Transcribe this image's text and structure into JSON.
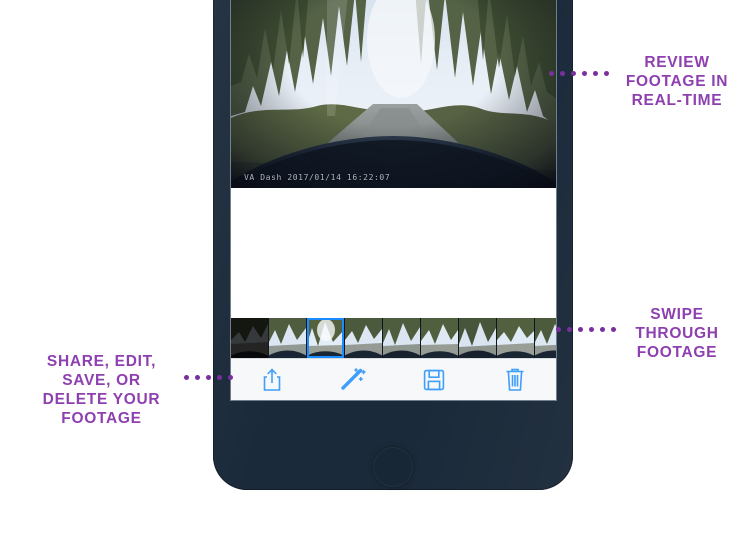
{
  "device": {
    "name": "smartphone-mockup",
    "body_color": "#1b2a3a",
    "home_button": "home-button"
  },
  "app": {
    "screen_name": "dash-cam-footage-viewer",
    "video": {
      "timestamp_overlay": "VA Dash 2017/01/14 16:22:07",
      "description": "forest road dash cam view"
    },
    "filmstrip": {
      "selected_index": 2,
      "thumbnails": [
        {
          "label": "clip-1",
          "dark": true
        },
        {
          "label": "clip-2",
          "dark": false
        },
        {
          "label": "clip-3",
          "dark": false
        },
        {
          "label": "clip-4",
          "dark": false
        },
        {
          "label": "clip-5",
          "dark": false
        },
        {
          "label": "clip-6",
          "dark": false
        },
        {
          "label": "clip-7",
          "dark": false
        },
        {
          "label": "clip-8",
          "dark": false
        },
        {
          "label": "clip-9",
          "dark": false
        }
      ]
    },
    "toolbar": {
      "share_label": "Share",
      "edit_label": "Edit",
      "save_label": "Save",
      "delete_label": "Delete",
      "icon_color": "#3f9dfb"
    }
  },
  "callouts": {
    "color": "#8e3fb0",
    "review": "REVIEW\nFOOTAGE IN\nREAL-TIME",
    "swipe": "SWIPE\nTHROUGH\nFOOTAGE",
    "share": "SHARE, EDIT,\nSAVE, OR\nDELETE YOUR\nFOOTAGE"
  }
}
